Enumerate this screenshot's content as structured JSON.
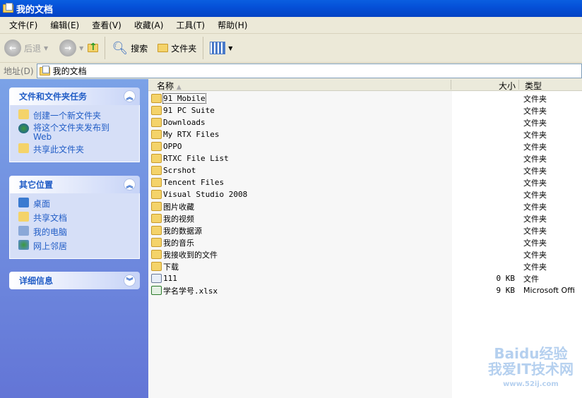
{
  "window": {
    "title": "我的文档"
  },
  "menu": [
    "文件(F)",
    "编辑(E)",
    "查看(V)",
    "收藏(A)",
    "工具(T)",
    "帮助(H)"
  ],
  "toolbar": {
    "back": "后退",
    "search": "搜索",
    "folders": "文件夹"
  },
  "address": {
    "label": "地址(D)",
    "value": "我的文档"
  },
  "sidebar": {
    "tasks": {
      "title": "文件和文件夹任务",
      "items": [
        "创建一个新文件夹",
        "将这个文件夹发布到 Web",
        "共享此文件夹"
      ]
    },
    "places": {
      "title": "其它位置",
      "items": [
        "桌面",
        "共享文档",
        "我的电脑",
        "网上邻居"
      ]
    },
    "details": {
      "title": "详细信息"
    }
  },
  "columns": {
    "name": "名称",
    "size": "大小",
    "type": "类型"
  },
  "files": [
    {
      "name": "91 Mobile",
      "size": "",
      "type": "文件夹",
      "icon": "folder"
    },
    {
      "name": "91 PC Suite",
      "size": "",
      "type": "文件夹",
      "icon": "folder"
    },
    {
      "name": "Downloads",
      "size": "",
      "type": "文件夹",
      "icon": "folder"
    },
    {
      "name": "My RTX Files",
      "size": "",
      "type": "文件夹",
      "icon": "folder"
    },
    {
      "name": "OPPO",
      "size": "",
      "type": "文件夹",
      "icon": "folder"
    },
    {
      "name": "RTXC File List",
      "size": "",
      "type": "文件夹",
      "icon": "folder"
    },
    {
      "name": "Scrshot",
      "size": "",
      "type": "文件夹",
      "icon": "folder"
    },
    {
      "name": "Tencent Files",
      "size": "",
      "type": "文件夹",
      "icon": "folder"
    },
    {
      "name": "Visual Studio 2008",
      "size": "",
      "type": "文件夹",
      "icon": "folder"
    },
    {
      "name": "图片收藏",
      "size": "",
      "type": "文件夹",
      "icon": "pictures-folder"
    },
    {
      "name": "我的视频",
      "size": "",
      "type": "文件夹",
      "icon": "video-folder"
    },
    {
      "name": "我的数据源",
      "size": "",
      "type": "文件夹",
      "icon": "datasource-folder"
    },
    {
      "name": "我的音乐",
      "size": "",
      "type": "文件夹",
      "icon": "music-folder"
    },
    {
      "name": "我接收到的文件",
      "size": "",
      "type": "文件夹",
      "icon": "folder"
    },
    {
      "name": "下载",
      "size": "",
      "type": "文件夹",
      "icon": "folder"
    },
    {
      "name": "111",
      "size": "0 KB",
      "type": "文件",
      "icon": "file"
    },
    {
      "name": "学名学号.xlsx",
      "size": "9 KB",
      "type": "Microsoft Offi",
      "icon": "excel"
    }
  ],
  "watermark": {
    "line1": "Baidu经验",
    "line2": "我爱IT技术网",
    "line3": "www.52ij.com"
  }
}
